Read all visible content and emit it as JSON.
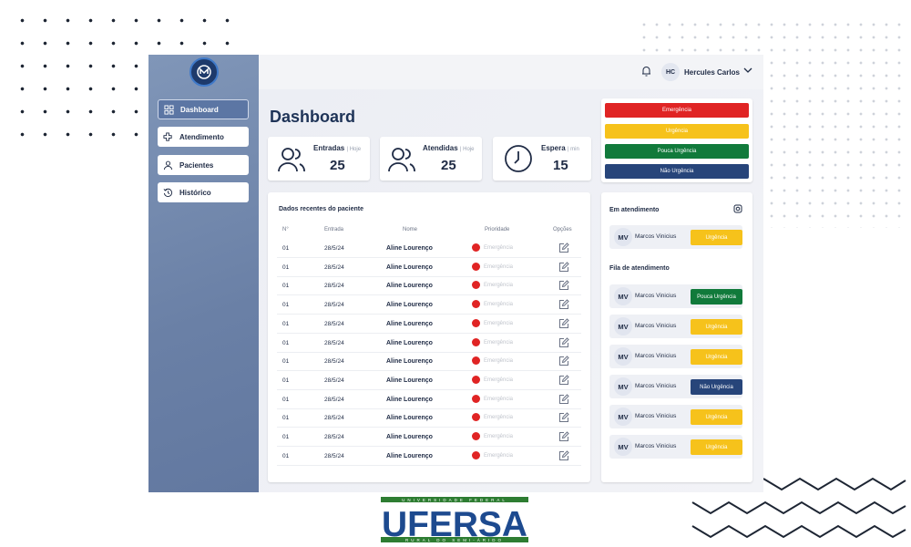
{
  "colors": {
    "emergencia": "#e02424",
    "urgencia": "#f6c21b",
    "pouca_urgencia": "#117a3b",
    "nao_urgencia": "#27457a",
    "sidebar": "#6a80a6",
    "brand": "#1e3a6b"
  },
  "sidebar": {
    "items": [
      {
        "label": "Dashboard",
        "icon": "dashboard-grid-icon",
        "active": true
      },
      {
        "label": "Atendimento",
        "icon": "medical-cross-icon"
      },
      {
        "label": "Pacientes",
        "icon": "person-icon"
      },
      {
        "label": "Histórico",
        "icon": "history-icon"
      }
    ]
  },
  "topbar": {
    "user_initials": "HC",
    "user_name": "Hercules Carlos"
  },
  "main": {
    "title": "Dashboard"
  },
  "stats": {
    "entradas": {
      "label": "Entradas",
      "sub": "| Hoje",
      "value": "25"
    },
    "atendidas": {
      "label": "Atendidas",
      "sub": "| Hoje",
      "value": "25"
    },
    "espera": {
      "label": "Espera",
      "sub": "| min",
      "value": "15"
    }
  },
  "priorities": [
    "Emergência",
    "Urgência",
    "Pouca Urgência",
    "Não Urgência"
  ],
  "table": {
    "title": "Dados recentes do paciente",
    "columns": [
      "N°",
      "Entrada",
      "Nome",
      "Prioridade",
      "Opções"
    ],
    "rows": [
      [
        "01",
        "28/5/24",
        "Aline Lourenço",
        "Emergência"
      ],
      [
        "01",
        "28/5/24",
        "Aline Lourenço",
        "Emergência"
      ],
      [
        "01",
        "28/5/24",
        "Aline Lourenço",
        "Emergência"
      ],
      [
        "01",
        "28/5/24",
        "Aline Lourenço",
        "Emergência"
      ],
      [
        "01",
        "28/5/24",
        "Aline Lourenço",
        "Emergência"
      ],
      [
        "01",
        "28/5/24",
        "Aline Lourenço",
        "Emergência"
      ],
      [
        "01",
        "28/5/24",
        "Aline Lourenço",
        "Emergência"
      ],
      [
        "01",
        "28/5/24",
        "Aline Lourenço",
        "Emergência"
      ],
      [
        "01",
        "28/5/24",
        "Aline Lourenço",
        "Emergência"
      ],
      [
        "01",
        "28/5/24",
        "Aline Lourenço",
        "Emergência"
      ],
      [
        "01",
        "28/5/24",
        "Aline Lourenço",
        "Emergência"
      ],
      [
        "01",
        "28/5/24",
        "Aline Lourenço",
        "Emergência"
      ]
    ]
  },
  "queue": {
    "in_service_title": "Em atendimento",
    "in_service": [
      {
        "initials": "MV",
        "name": "Marcos Vinicius",
        "priority": "Urgência"
      }
    ],
    "line_title": "Fila de atendimento",
    "line": [
      {
        "initials": "MV",
        "name": "Marcos Vinicius",
        "priority": "Pouca Urgência"
      },
      {
        "initials": "MV",
        "name": "Marcos Vinicius",
        "priority": "Urgência"
      },
      {
        "initials": "MV",
        "name": "Marcos Vinicius",
        "priority": "Urgência"
      },
      {
        "initials": "MV",
        "name": "Marcos Vinicius",
        "priority": "Não Urgência"
      },
      {
        "initials": "MV",
        "name": "Marcos Vinicius",
        "priority": "Urgência"
      },
      {
        "initials": "MV",
        "name": "Marcos Vinicius",
        "priority": "Urgência"
      }
    ]
  },
  "footer_logo": {
    "top": "UNIVERSIDADE FEDERAL",
    "name": "UFERSA",
    "bottom": "RURAL DO SEMI-ÁRIDO"
  }
}
